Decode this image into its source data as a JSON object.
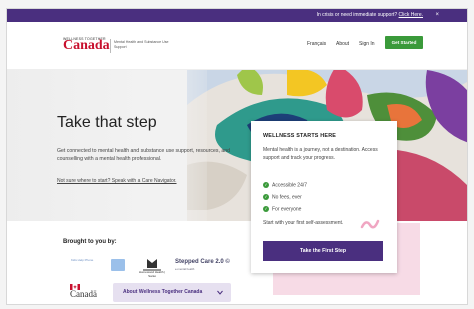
{
  "crisis_bar": {
    "text": "In crisis or need immediate support?",
    "link": "Click Here.",
    "close": "×"
  },
  "header": {
    "logo_small": "Wellness Together",
    "logo_main": "Canada",
    "logo_tagline": "Mental Health and Substance Use Support",
    "nav": [
      "Français",
      "About",
      "Sign In"
    ],
    "cta": "Get Started"
  },
  "hero": {
    "title": "Take that step",
    "body": "Get connected to mental health and substance use support, resources, and counselling with a mental health professional.",
    "link": "Not sure where to start? Speak with a Care Navigator."
  },
  "card": {
    "title": "WELLNESS STARTS HERE",
    "description": "Mental health is a journey, not a destination. Access support and track your progress.",
    "items": [
      "Accessible 24/7",
      "No fees, ever",
      "For everyone"
    ],
    "note": "Start with your first self-assessment.",
    "button": "Take the First Step"
  },
  "partners": {
    "heading": "Brought to you by:",
    "p1": "Kids Help Phone",
    "p2": "Homewood Health | Santé",
    "p3": "Stepped Care 2.0 ©",
    "p3_sub": "e-mental health",
    "gov": "Canadä",
    "about_button": "About Wellness Together Canada"
  },
  "colors": {
    "purple": "#4a2f7f",
    "green": "#3a9a3a",
    "pink": "#f7dbe6",
    "canada_red": "#c8102e"
  }
}
